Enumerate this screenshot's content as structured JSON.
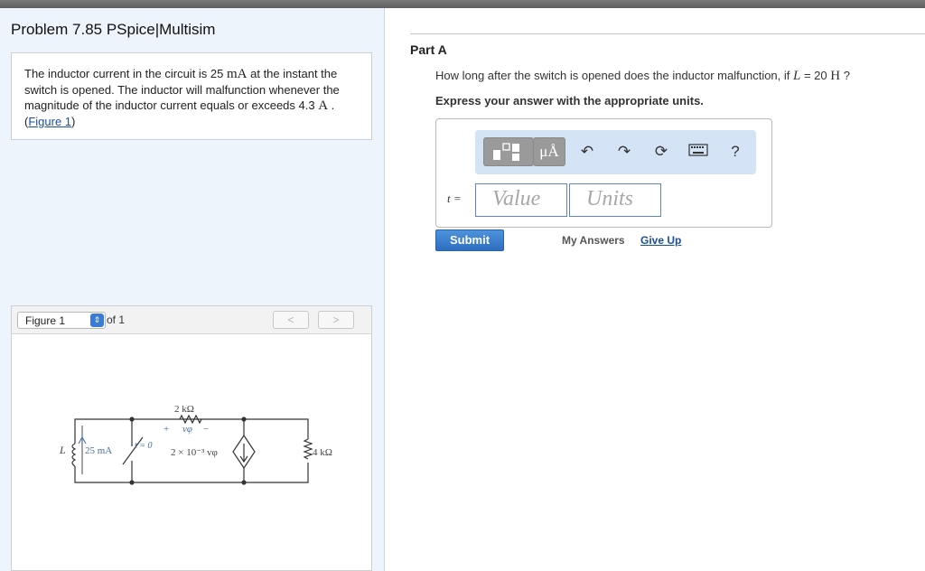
{
  "problem": {
    "title": "Problem 7.85 PSpice|Multisim",
    "text_part1": "The inductor current in the circuit is 25 ",
    "current_value": "mA",
    "text_part2": " at the instant the switch is opened. The inductor will malfunction whenever the magnitude of the inductor current equals or exceeds 4.3 ",
    "threshold_unit": "A",
    "text_part3": " . (",
    "figure_link": "Figure 1",
    "text_part4": ")"
  },
  "figure": {
    "selector_value": "Figure 1",
    "of_label": "of 1",
    "prev_label": "<",
    "next_label": ">",
    "labels": {
      "inductor": "L",
      "source_current": "25 mA",
      "switch": "t = 0",
      "resistor_top": "2 kΩ",
      "vphi_plus": "+",
      "vphi": "vφ",
      "vphi_minus": "−",
      "dependent_source": "2 × 10⁻³ vφ",
      "resistor_right": "4 kΩ"
    }
  },
  "part": {
    "label": "Part A",
    "question_part1": "How long after the switch is opened does the inductor malfunction, if ",
    "question_var": "L",
    "question_eq": " = 20 ",
    "question_unit": "H",
    "question_end": " ?",
    "instruction": "Express your answer with the appropriate units."
  },
  "toolbar": {
    "units_label": "μÅ",
    "undo_icon": "undo-icon",
    "redo_icon": "redo-icon",
    "reset_icon": "reset-icon",
    "keyboard_icon": "keyboard-icon",
    "help_label": "?"
  },
  "answer": {
    "var_label": "t =",
    "value_placeholder": "Value",
    "units_placeholder": "Units"
  },
  "actions": {
    "submit": "Submit",
    "my_answers": "My Answers",
    "give_up": "Give Up"
  }
}
